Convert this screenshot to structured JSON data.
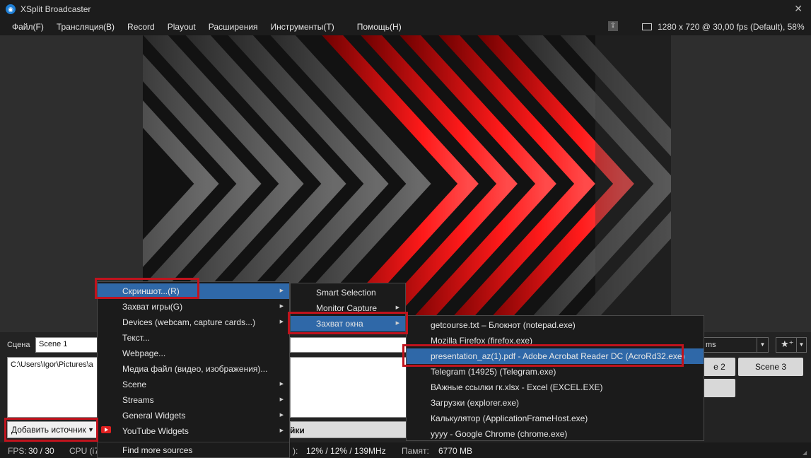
{
  "window": {
    "title": "XSplit Broadcaster",
    "close_glyph": "✕"
  },
  "menubar": {
    "items": [
      "Файл(F)",
      "Трансляция(B)",
      "Record",
      "Playout",
      "Расширения",
      "Инструменты(T)",
      "Помощь(H)"
    ],
    "resolution": "1280 x 720 @ 30,00 fps (Default), 58%"
  },
  "scene": {
    "label": "Сцена",
    "name": "Scene 1"
  },
  "sources": {
    "items": [
      "C:\\Users\\Igor\\Pictures\\a"
    ]
  },
  "add_source_button": "Добавить источник",
  "settings_tab": "йки",
  "streams_select": "ms",
  "scene_buttons": [
    "e 2",
    "Scene 3"
  ],
  "status": {
    "fps_label": "FPS:",
    "fps_value": "30 / 30",
    "cpu_label": "CPU (i7",
    "gpu_label": "):",
    "gpu_value": "12% / 12% / 139MHz",
    "mem_label": "Памят:",
    "mem_value": "6770 MB"
  },
  "menu_add_source": {
    "items": [
      {
        "label": "Скриншот...(R)",
        "submenu": true,
        "highlighted": true
      },
      {
        "label": "Захват игры(G)",
        "submenu": true
      },
      {
        "label": "Devices (webcam, capture cards...)",
        "submenu": true
      },
      {
        "label": "Текст...",
        "submenu": false
      },
      {
        "label": "Webpage...",
        "submenu": false
      },
      {
        "label": "Медиа файл (видео, изображения)...",
        "submenu": false
      },
      {
        "label": "Scene",
        "submenu": true
      },
      {
        "label": "Streams",
        "submenu": true
      },
      {
        "label": "General Widgets",
        "submenu": true
      },
      {
        "label": "YouTube Widgets",
        "submenu": true
      },
      {
        "label": "Find more sources",
        "submenu": false
      }
    ]
  },
  "menu_screenshot": {
    "items": [
      {
        "label": "Smart Selection",
        "submenu": false
      },
      {
        "label": "Monitor Capture",
        "submenu": true
      },
      {
        "label": "Захват окна",
        "submenu": true,
        "highlighted": true
      }
    ]
  },
  "menu_windows": {
    "items": [
      {
        "label": "getcourse.txt – Блокнот (notepad.exe)"
      },
      {
        "label": "Mozilla Firefox (firefox.exe)"
      },
      {
        "label": "presentation_az(1).pdf - Adobe Acrobat Reader DC (AcroRd32.exe)",
        "highlighted": true
      },
      {
        "label": "Telegram (14925) (Telegram.exe)"
      },
      {
        "label": "ВАжные ссылки гк.xlsx - Excel (EXCEL.EXE)"
      },
      {
        "label": "Загрузки (explorer.exe)"
      },
      {
        "label": "Калькулятор (ApplicationFrameHost.exe)"
      },
      {
        "label": "yyyy - Google Chrome (chrome.exe)"
      }
    ]
  },
  "colors": {
    "highlight": "#2f68a8",
    "annotation_red": "#c0131d",
    "accent_red": "#e01a1a"
  }
}
